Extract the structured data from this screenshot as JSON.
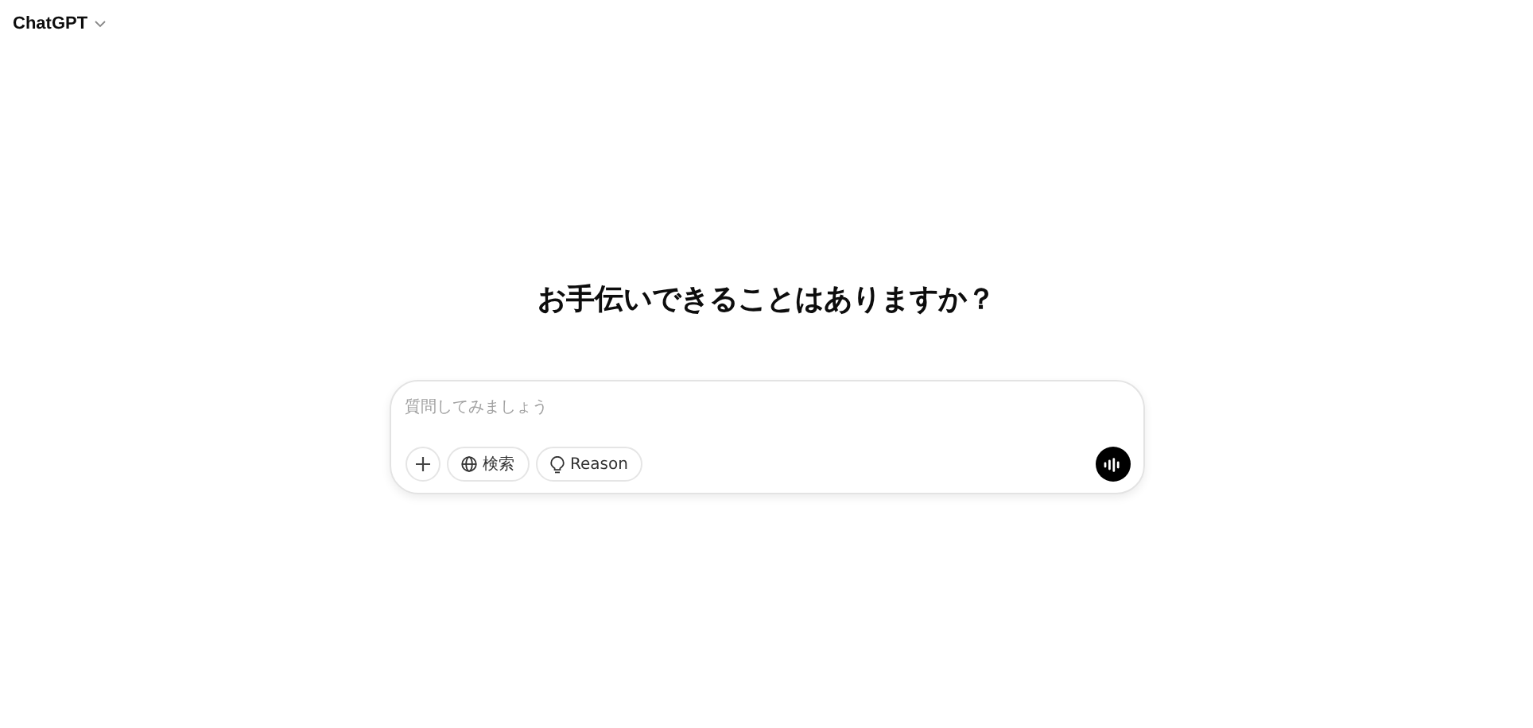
{
  "header": {
    "title": "ChatGPT"
  },
  "heading": "お手伝いできることはありますか？",
  "composer": {
    "placeholder": "質問してみましょう",
    "tools": [
      {
        "kind": "add"
      },
      {
        "kind": "search",
        "label": "検索"
      },
      {
        "kind": "reason",
        "label": "Reason"
      }
    ]
  }
}
